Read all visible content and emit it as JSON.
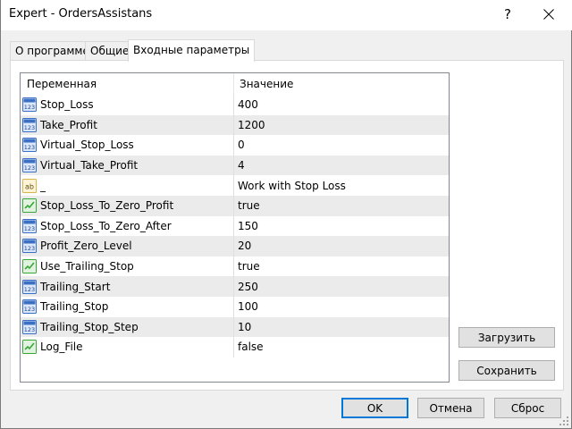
{
  "window": {
    "title": "Expert - OrdersAssistans",
    "help_label": "?"
  },
  "tabs": [
    {
      "label": "О программе",
      "active": false
    },
    {
      "label": "Общие",
      "active": false
    },
    {
      "label": "Входные параметры",
      "active": true
    }
  ],
  "grid": {
    "columns": [
      "Переменная",
      "Значение"
    ],
    "rows": [
      {
        "icon": "int-icon",
        "name": "Stop_Loss",
        "value": "400"
      },
      {
        "icon": "int-icon",
        "name": "Take_Profit",
        "value": "1200"
      },
      {
        "icon": "int-icon",
        "name": "Virtual_Stop_Loss",
        "value": "0"
      },
      {
        "icon": "int-icon",
        "name": "Virtual_Take_Profit",
        "value": "4"
      },
      {
        "icon": "string-icon",
        "name": "_",
        "value": "Work with Stop Loss"
      },
      {
        "icon": "bool-icon",
        "name": "Stop_Loss_To_Zero_Profit",
        "value": "true"
      },
      {
        "icon": "int-icon",
        "name": "Stop_Loss_To_Zero_After",
        "value": "150"
      },
      {
        "icon": "int-icon",
        "name": "Profit_Zero_Level",
        "value": "20"
      },
      {
        "icon": "bool-icon",
        "name": "Use_Trailing_Stop",
        "value": "true"
      },
      {
        "icon": "int-icon",
        "name": "Trailing_Start",
        "value": "250"
      },
      {
        "icon": "int-icon",
        "name": "Trailing_Stop",
        "value": "100"
      },
      {
        "icon": "int-icon",
        "name": "Trailing_Stop_Step",
        "value": "10"
      },
      {
        "icon": "bool-icon",
        "name": "Log_File",
        "value": "false"
      }
    ]
  },
  "side_buttons": {
    "load": "Загрузить",
    "save": "Сохранить"
  },
  "footer_buttons": {
    "ok": "OK",
    "cancel": "Отмена",
    "reset": "Сброс"
  },
  "colors": {
    "default_button_border": "#0078d7",
    "int_icon": "#3a6fc4",
    "string_icon": "#d9b44a",
    "bool_icon": "#3aa53a"
  }
}
